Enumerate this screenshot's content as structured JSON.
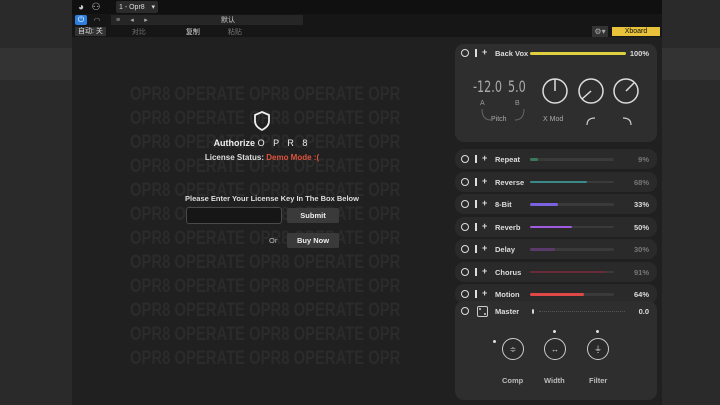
{
  "host": {
    "title_preset": "1 - Opr8",
    "preset_name": "默认",
    "auto_label": "自动: 关",
    "compare_label": "对比",
    "copy_label": "复制",
    "paste_label": "粘贴",
    "xboard_label": "Xboard",
    "colors": {
      "power": "#2f7fe0",
      "xboard": "#e8c23a"
    }
  },
  "watermark": {
    "lines": [
      "OPR8 OPERATE OPR8 OPERATE OPR8",
      "OPR8 OPERATE OPR8 OPERATE OPR8",
      "OPR8 OPERATE OPR8 OPERATE OPR8",
      "OPR8 OPERATE OPR8 OPERATE OPR8",
      "OPR8 OPERATE OPR8 OPERATE OPR8",
      "OPR8 OPERATE OPR8 OPERATE OPR8",
      "OPR8 OPERATE OPR8 OPERATE OPR8",
      "OPR8 OPERATE OPR8 OPERATE OPR8",
      "OPR8 OPERATE OPR8 OPERATE OPR8",
      "OPR8 OPERATE OPR8 OPERATE OPR8",
      "OPR8 OPERATE OPR8 OPERATE OPR8",
      "OPR8 OPERATE OPR8 OPERATE OPR8"
    ]
  },
  "license": {
    "authorize_prefix": "Authorize",
    "product": "O P R 8",
    "status_label": "License Status:",
    "status_value": "Demo Mode :(",
    "prompt": "Please Enter Your License Key In The Box Below",
    "key_value": "",
    "submit_label": "Submit",
    "or_label": "Or",
    "buy_label": "Buy Now"
  },
  "voice": {
    "name": "Back Vox",
    "level_percent": 100,
    "level_label": "100%",
    "pitch_a": "-12.0",
    "pitch_b": "5.0",
    "a_label": "A",
    "b_label": "B",
    "pitch_label": "Pitch",
    "xmod_label": "X Mod",
    "color": "#e0d040"
  },
  "effects": [
    {
      "name": "Repeat",
      "value": 9,
      "label": "9%",
      "color": "#3a7a5a",
      "active": false
    },
    {
      "name": "Reverse",
      "value": 68,
      "label": "68%",
      "color": "#3a8a8a",
      "active": false
    },
    {
      "name": "8-Bit",
      "value": 33,
      "label": "33%",
      "color": "#7a62e0",
      "active": true
    },
    {
      "name": "Reverb",
      "value": 50,
      "label": "50%",
      "color": "#a05ce0",
      "active": true
    },
    {
      "name": "Delay",
      "value": 30,
      "label": "30%",
      "color": "#5a3a6a",
      "active": false
    },
    {
      "name": "Chorus",
      "value": 91,
      "label": "91%",
      "color": "#6a2a3a",
      "active": false
    },
    {
      "name": "Motion",
      "value": 64,
      "label": "64%",
      "color": "#e04848",
      "active": true
    }
  ],
  "master": {
    "name": "Master",
    "value_label": "0.0",
    "comp_label": "Comp",
    "width_label": "Width",
    "filter_label": "Filter"
  }
}
